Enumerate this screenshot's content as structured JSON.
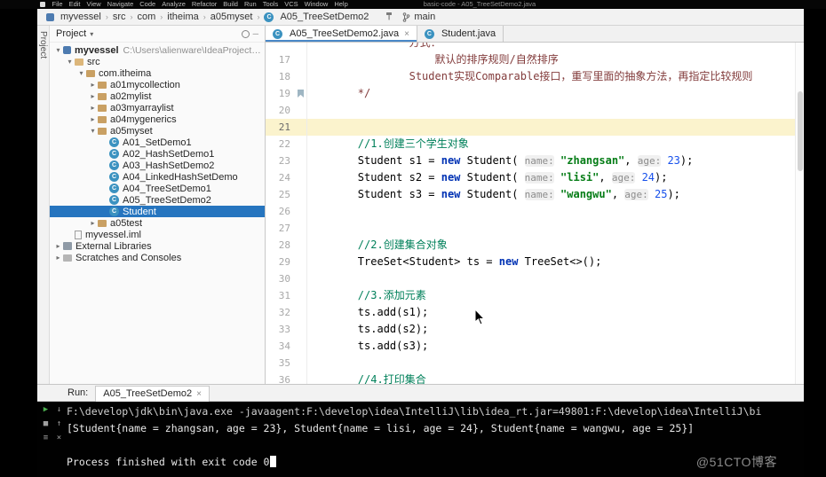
{
  "window": {
    "title": "basic-code - A05_TreeSetDemo2.java"
  },
  "menu_bar": {
    "items": [
      "File",
      "Edit",
      "View",
      "Navigate",
      "Code",
      "Analyze",
      "Refactor",
      "Build",
      "Run",
      "Tools",
      "VCS",
      "Window",
      "Help"
    ]
  },
  "nav_bar": {
    "crumbs": [
      {
        "label": "myvessel",
        "icon": "module"
      },
      {
        "label": "src"
      },
      {
        "label": "com"
      },
      {
        "label": "itheima"
      },
      {
        "label": "a05myset"
      },
      {
        "label": "A05_TreeSetDemo2",
        "icon": "class"
      }
    ],
    "git_branch": "main"
  },
  "project_panel": {
    "stripe_label": "Project",
    "header_title": "Project",
    "tree": [
      {
        "label": "myvessel",
        "detail": "C:\\Users\\alienware\\IdeaProjects\\basic-cod",
        "level": 0,
        "icon": "module",
        "arrow": "down",
        "bold": true
      },
      {
        "label": "src",
        "level": 1,
        "icon": "folder",
        "arrow": "down"
      },
      {
        "label": "com.itheima",
        "level": 2,
        "icon": "package",
        "arrow": "down"
      },
      {
        "label": "a01mycollection",
        "level": 3,
        "icon": "package",
        "arrow": "right"
      },
      {
        "label": "a02mylist",
        "level": 3,
        "icon": "package",
        "arrow": "right"
      },
      {
        "label": "a03myarraylist",
        "level": 3,
        "icon": "package",
        "arrow": "right"
      },
      {
        "label": "a04mygenerics",
        "level": 3,
        "icon": "package",
        "arrow": "right"
      },
      {
        "label": "a05myset",
        "level": 3,
        "icon": "package",
        "arrow": "down"
      },
      {
        "label": "A01_SetDemo1",
        "level": 4,
        "icon": "class"
      },
      {
        "label": "A02_HashSetDemo1",
        "level": 4,
        "icon": "class"
      },
      {
        "label": "A03_HashSetDemo2",
        "level": 4,
        "icon": "class"
      },
      {
        "label": "A04_LinkedHashSetDemo",
        "level": 4,
        "icon": "class"
      },
      {
        "label": "A04_TreeSetDemo1",
        "level": 4,
        "icon": "class"
      },
      {
        "label": "A05_TreeSetDemo2",
        "level": 4,
        "icon": "class"
      },
      {
        "label": "Student",
        "level": 4,
        "icon": "class",
        "selected": true
      },
      {
        "label": "a05test",
        "level": 3,
        "icon": "package",
        "arrow": "right"
      },
      {
        "label": "myvessel.iml",
        "level": 1,
        "icon": "file"
      },
      {
        "label": "External Libraries",
        "level": 0,
        "icon": "libraries",
        "arrow": "right"
      },
      {
        "label": "Scratches and Consoles",
        "level": 0,
        "icon": "scratches",
        "arrow": "right"
      }
    ]
  },
  "editor": {
    "tabs": [
      {
        "label": "A05_TreeSetDemo2.java",
        "active": true,
        "close": "×"
      },
      {
        "label": "Student.java",
        "active": false
      }
    ],
    "lines": [
      {
        "num": "",
        "tokens": [
          {
            "c": "doc",
            "t": "                方式："
          }
        ]
      },
      {
        "num": "17",
        "tokens": [
          {
            "c": "doc",
            "t": "                    默认的排序规则/自然排序"
          }
        ]
      },
      {
        "num": "18",
        "tokens": [
          {
            "c": "doc",
            "t": "                Student实现Comparable接口，重写里面的抽象方法，再指定比较规则"
          }
        ]
      },
      {
        "num": "19",
        "bookmark": true,
        "tokens": [
          {
            "c": "doc",
            "t": "        */"
          }
        ]
      },
      {
        "num": "20",
        "tokens": []
      },
      {
        "num": "21",
        "hl": true,
        "tokens": []
      },
      {
        "num": "22",
        "tokens": [
          {
            "c": "cmt",
            "t": "        //1.创建三个学生对象"
          }
        ]
      },
      {
        "num": "23",
        "tokens": [
          {
            "c": "pln",
            "t": "        Student s1 = "
          },
          {
            "c": "kw",
            "t": "new"
          },
          {
            "c": "pln",
            "t": " Student( "
          },
          {
            "c": "hint",
            "t": "name:"
          },
          {
            "c": "pln",
            "t": " "
          },
          {
            "c": "str",
            "t": "\"zhangsan\""
          },
          {
            "c": "pln",
            "t": ", "
          },
          {
            "c": "hint",
            "t": "age:"
          },
          {
            "c": "pln",
            "t": " "
          },
          {
            "c": "num",
            "t": "23"
          },
          {
            "c": "pln",
            "t": ");"
          }
        ]
      },
      {
        "num": "24",
        "tokens": [
          {
            "c": "pln",
            "t": "        Student s2 = "
          },
          {
            "c": "kw",
            "t": "new"
          },
          {
            "c": "pln",
            "t": " Student( "
          },
          {
            "c": "hint",
            "t": "name:"
          },
          {
            "c": "pln",
            "t": " "
          },
          {
            "c": "str",
            "t": "\"lisi\""
          },
          {
            "c": "pln",
            "t": ", "
          },
          {
            "c": "hint",
            "t": "age:"
          },
          {
            "c": "pln",
            "t": " "
          },
          {
            "c": "num",
            "t": "24"
          },
          {
            "c": "pln",
            "t": ");"
          }
        ]
      },
      {
        "num": "25",
        "tokens": [
          {
            "c": "pln",
            "t": "        Student s3 = "
          },
          {
            "c": "kw",
            "t": "new"
          },
          {
            "c": "pln",
            "t": " Student( "
          },
          {
            "c": "hint",
            "t": "name:"
          },
          {
            "c": "pln",
            "t": " "
          },
          {
            "c": "str",
            "t": "\"wangwu\""
          },
          {
            "c": "pln",
            "t": ", "
          },
          {
            "c": "hint",
            "t": "age:"
          },
          {
            "c": "pln",
            "t": " "
          },
          {
            "c": "num",
            "t": "25"
          },
          {
            "c": "pln",
            "t": ");"
          }
        ]
      },
      {
        "num": "26",
        "tokens": []
      },
      {
        "num": "27",
        "tokens": []
      },
      {
        "num": "28",
        "tokens": [
          {
            "c": "cmt",
            "t": "        //2.创建集合对象"
          }
        ]
      },
      {
        "num": "29",
        "tokens": [
          {
            "c": "pln",
            "t": "        TreeSet<Student> ts = "
          },
          {
            "c": "kw",
            "t": "new"
          },
          {
            "c": "pln",
            "t": " TreeSet<>();"
          }
        ]
      },
      {
        "num": "30",
        "tokens": []
      },
      {
        "num": "31",
        "tokens": [
          {
            "c": "cmt",
            "t": "        //3.添加元素"
          }
        ]
      },
      {
        "num": "32",
        "tokens": [
          {
            "c": "pln",
            "t": "        ts.add(s1);"
          }
        ]
      },
      {
        "num": "33",
        "tokens": [
          {
            "c": "pln",
            "t": "        ts.add(s2);"
          }
        ]
      },
      {
        "num": "34",
        "tokens": [
          {
            "c": "pln",
            "t": "        ts.add(s3);"
          }
        ]
      },
      {
        "num": "35",
        "tokens": []
      },
      {
        "num": "36",
        "tokens": [
          {
            "c": "cmt",
            "t": "        //4.打印集合"
          }
        ]
      }
    ]
  },
  "run_panel": {
    "label": "Run:",
    "tab_label": "A05_TreeSetDemo2",
    "tab_close": "×",
    "console": [
      {
        "text": "F:\\develop\\jdk\\bin\\java.exe -javaagent:F:\\develop\\idea\\IntelliJ\\lib\\idea_rt.jar=49801:F:\\develop\\idea\\IntelliJ\\bi",
        "dim": true
      },
      {
        "text": "[Student{name = zhangsan, age = 23}, Student{name = lisi, age = 24}, Student{name = wangwu, age = 25}]"
      },
      {
        "text": ""
      },
      {
        "text": "Process finished with exit code 0",
        "caret": true
      }
    ]
  },
  "watermark": "@51CTO博客"
}
